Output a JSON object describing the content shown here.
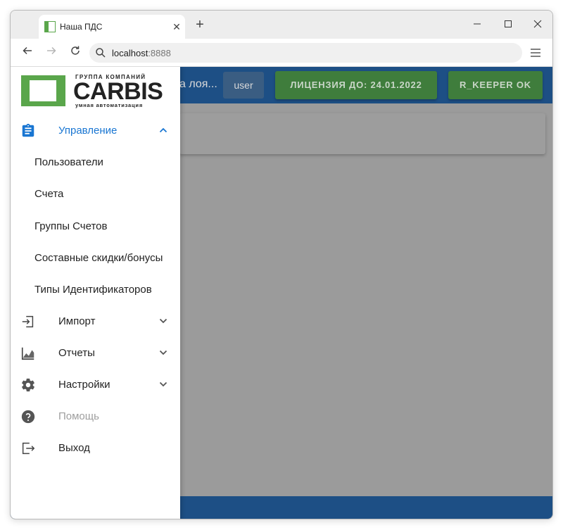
{
  "browser": {
    "tab_title": "Наша ПДС",
    "new_tab": "+",
    "url_host": "localhost",
    "url_port": ":8888",
    "minimize": "—",
    "maximize": "☐",
    "close": "✕"
  },
  "appbar": {
    "title_fragment": "а лоя...",
    "user": "user",
    "license": "ЛИЦЕНЗИЯ ДО: 24.01.2022",
    "keeper_status": "R_KEEPER OK",
    "primary_color": "#1d4f85",
    "success_color": "#3f7d3c"
  },
  "logo": {
    "top_text": "ГРУППА КОМПАНИЙ",
    "main_text": "CARBIS",
    "sub_text": "умная автоматизация",
    "brand_color": "#5aa64b"
  },
  "drawer": {
    "management": {
      "label": "Управление",
      "icon": "clipboard-icon",
      "color": "#1976d2"
    },
    "sub_items": [
      "Пользователи",
      "Счета",
      "Группы Счетов",
      "Составные скидки/бонусы",
      "Типы Идентификаторов"
    ],
    "import": {
      "label": "Импорт",
      "icon": "import-icon"
    },
    "reports": {
      "label": "Отчеты",
      "icon": "chart-icon"
    },
    "settings": {
      "label": "Настройки",
      "icon": "gear-icon"
    },
    "help": {
      "label": "Помощь",
      "icon": "help-icon"
    },
    "logout": {
      "label": "Выход",
      "icon": "logout-icon"
    }
  }
}
